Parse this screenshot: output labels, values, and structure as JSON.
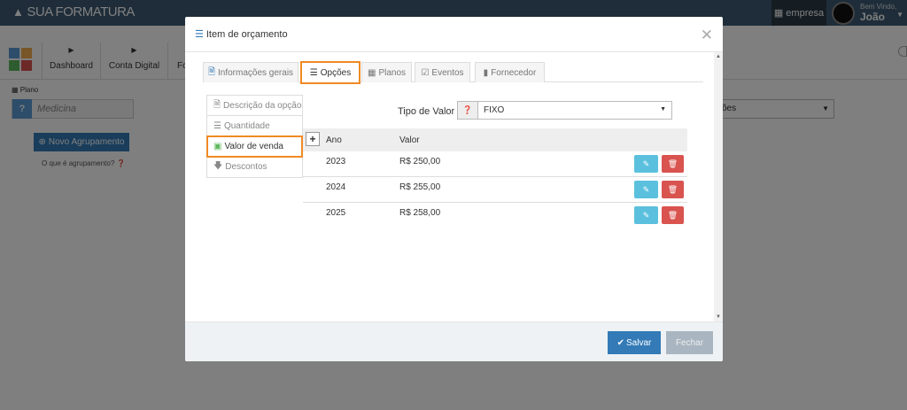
{
  "brand": {
    "logo_text": "SUA FORMATURA"
  },
  "topbar": {
    "empresa": "empresa",
    "welcome": "Bem Vindo,",
    "user_name": "João"
  },
  "nav": {
    "items": [
      "Dashboard",
      "Conta Digital",
      "Fo"
    ]
  },
  "background": {
    "plano_label": "Plano",
    "plano_value": "Medicina",
    "novo_agrupamento": "Novo Agrupamento",
    "oque_agrupamento": "O que é agrupamento?",
    "select_partial": "ões"
  },
  "modal": {
    "title": "Item de orçamento",
    "tabs": [
      "Informações gerais",
      "Opções",
      "Planos",
      "Eventos",
      "Fornecedor"
    ],
    "active_tab": "Opções",
    "side_tabs": [
      "Descrição da opção",
      "Quantidade",
      "Valor de venda",
      "Descontos"
    ],
    "active_side_tab": "Valor de venda",
    "tipo_valor_label": "Tipo de Valor",
    "tipo_valor_value": "FIXO",
    "table": {
      "headers": [
        "Ano",
        "Valor"
      ],
      "rows": [
        {
          "ano": "2023",
          "valor": "R$ 250,00"
        },
        {
          "ano": "2024",
          "valor": "R$ 255,00"
        },
        {
          "ano": "2025",
          "valor": "R$ 258,00"
        }
      ]
    },
    "save_label": "Salvar",
    "close_label": "Fechar"
  },
  "colors": {
    "topbar": "#3d5a73",
    "primary": "#337ab7",
    "info": "#5bc0de",
    "danger": "#d9534f",
    "highlight": "#f08a24"
  }
}
